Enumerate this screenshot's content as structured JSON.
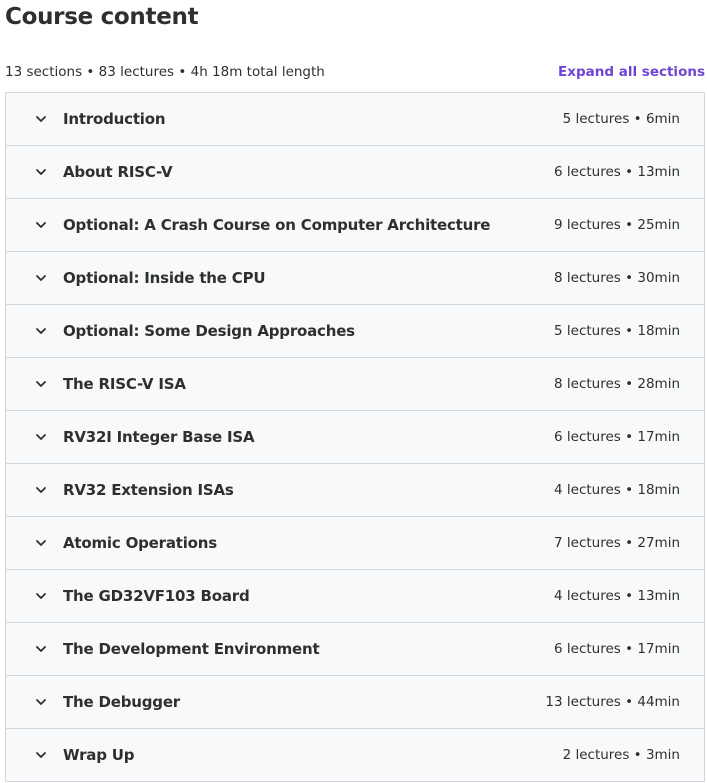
{
  "header": {
    "title": "Course content",
    "summary": "13 sections • 83 lectures • 4h 18m total length",
    "expand_label": "Expand all sections"
  },
  "sections": [
    {
      "title": "Introduction",
      "meta": "5 lectures • 6min"
    },
    {
      "title": "About RISC-V",
      "meta": "6 lectures • 13min"
    },
    {
      "title": "Optional: A Crash Course on Computer Architecture",
      "meta": "9 lectures • 25min"
    },
    {
      "title": "Optional: Inside the CPU",
      "meta": "8 lectures • 30min"
    },
    {
      "title": "Optional: Some Design Approaches",
      "meta": "5 lectures • 18min"
    },
    {
      "title": "The RISC-V ISA",
      "meta": "8 lectures • 28min"
    },
    {
      "title": "RV32I Integer Base ISA",
      "meta": "6 lectures • 17min"
    },
    {
      "title": "RV32 Extension ISAs",
      "meta": "4 lectures • 18min"
    },
    {
      "title": "Atomic Operations",
      "meta": "7 lectures • 27min"
    },
    {
      "title": "The GD32VF103 Board",
      "meta": "4 lectures • 13min"
    },
    {
      "title": "The Development Environment",
      "meta": "6 lectures • 17min"
    },
    {
      "title": "The Debugger",
      "meta": "13 lectures • 44min"
    },
    {
      "title": "Wrap Up",
      "meta": "2 lectures • 3min"
    }
  ],
  "colors": {
    "accent": "#5624d0",
    "text": "#2d2f31",
    "section_bg": "#f7f9fa",
    "border": "#d1d7dc"
  },
  "icons": {
    "section_toggle": "chevron-down-icon"
  }
}
